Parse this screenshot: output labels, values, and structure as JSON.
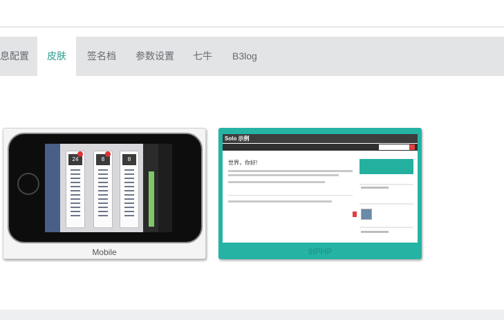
{
  "tabs": [
    {
      "label": "息配置",
      "active": false
    },
    {
      "label": "皮肤",
      "active": true
    },
    {
      "label": "签名档",
      "active": false
    },
    {
      "label": "参数设置",
      "active": false
    },
    {
      "label": "七牛",
      "active": false
    },
    {
      "label": "B3log",
      "active": false
    }
  ],
  "skins": [
    {
      "name": "Mobile",
      "preview": {
        "card_numbers": [
          "24",
          "8",
          "8"
        ]
      }
    },
    {
      "name": "9IPHP",
      "preview": {
        "site_title": "Solo 示例",
        "post_title": "世界，你好!"
      }
    }
  ],
  "colors": {
    "accent": "#2a9e93",
    "tabbar_bg": "#e3e4e6",
    "skin_9iphp_frame": "#25b3a4"
  }
}
